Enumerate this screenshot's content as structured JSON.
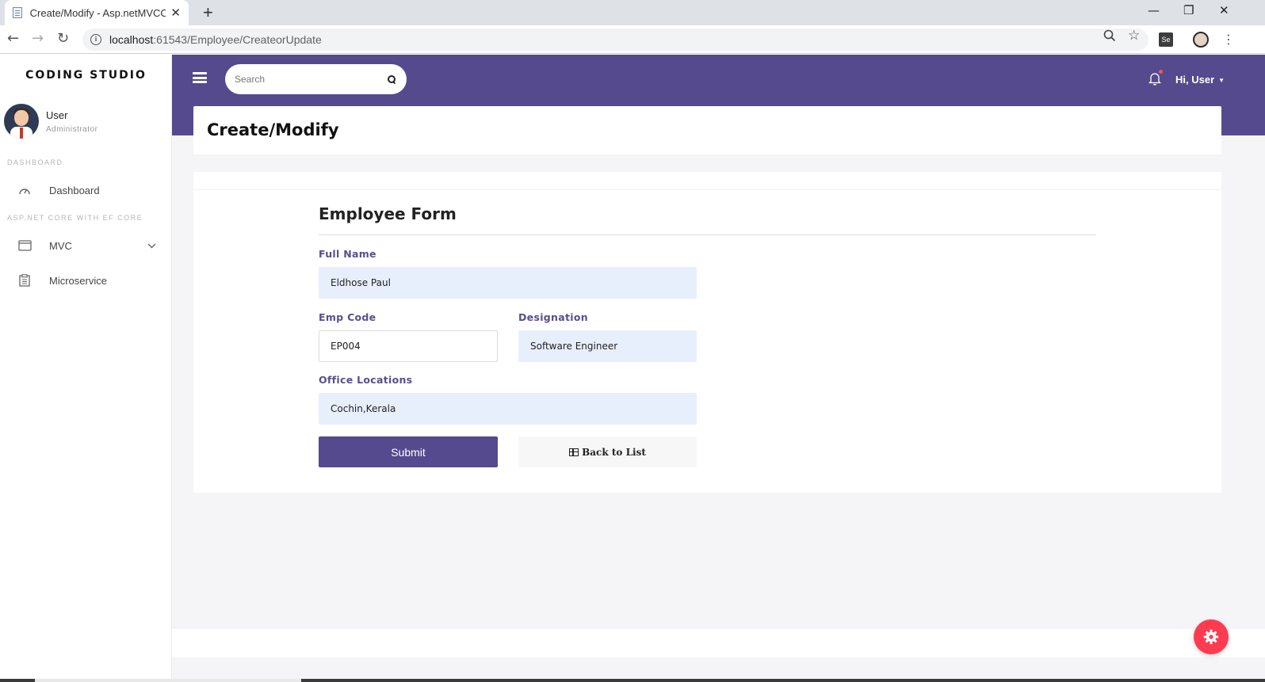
{
  "browser": {
    "tab_title": "Create/Modify - Asp.netMVCCore",
    "url_host": "localhost",
    "url_path": ":61543/Employee/CreateorUpdate",
    "ext_label": "Se"
  },
  "sidebar": {
    "brand": "CODING STUDIO",
    "user_name": "User",
    "user_role": "Administrator",
    "section_dashboard": "DASHBOARD",
    "section_core": "ASP.NET CORE WITH EF CORE",
    "items": [
      {
        "label": "Dashboard",
        "icon": "gauge-icon"
      },
      {
        "label": "MVC",
        "icon": "window-icon"
      },
      {
        "label": "Microservice",
        "icon": "clipboard-icon"
      }
    ]
  },
  "header": {
    "search_placeholder": "Search",
    "greeting": "Hi, User",
    "accent_color": "#554a8d"
  },
  "page": {
    "title": "Create/Modify"
  },
  "form": {
    "title": "Employee Form",
    "full_name_label": "Full Name",
    "full_name_value": "Eldhose Paul",
    "emp_code_label": "Emp Code",
    "emp_code_value": "EP004",
    "designation_label": "Designation",
    "designation_value": "Software Engineer",
    "office_label": "Office Locations",
    "office_value": "Cochin,Kerala",
    "submit_label": "Submit",
    "back_label": "Back to List"
  }
}
